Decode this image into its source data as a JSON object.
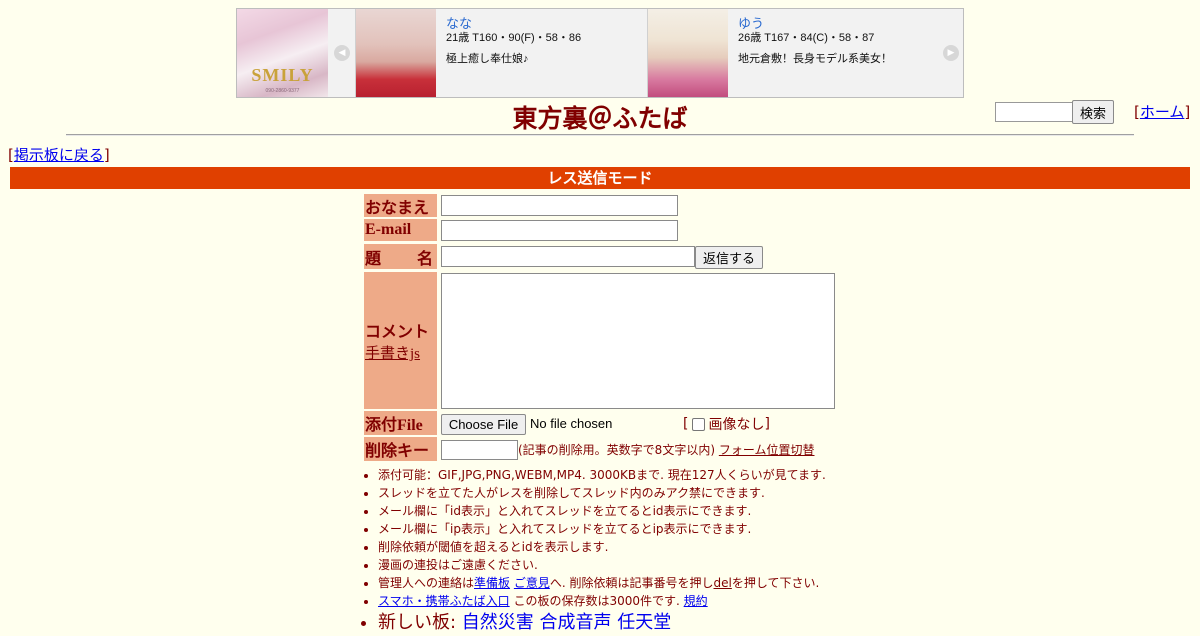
{
  "banner": {
    "shop_logo": "SMILY",
    "shop_sub": "090-2860-9377",
    "cards": [
      {
        "name": "なな",
        "spec": "21歳 T160・90(F)・58・86",
        "copy": "極上癒し奉仕娘♪"
      },
      {
        "name": "ゆう",
        "spec": "26歳 T167・84(C)・58・87",
        "copy": "地元倉敷！長身モデル系美女！"
      }
    ]
  },
  "header": {
    "title": "東方裏＠ふたば",
    "search_button": "検索",
    "home_link": "ホーム",
    "back_link": "掲示板に戻る"
  },
  "mode": "レス送信モード",
  "form": {
    "name_label": "おなまえ",
    "email_label": "E-mail",
    "subject_label_a": "題",
    "subject_label_b": "名",
    "submit": "返信する",
    "comment_label": "コメント",
    "handwriting": "手書きjs",
    "file_label": "添付File",
    "file_button": "Choose File",
    "file_status": "No file chosen",
    "no_image": "画像なし",
    "delkey_label": "削除キー",
    "delkey_note": "(記事の削除用。英数字で8文字以内)",
    "form_toggle": "フォーム位置切替"
  },
  "notes": {
    "n1": "添付可能：GIF,JPG,PNG,WEBM,MP4. 3000KBまで. 現在127人くらいが見てます.",
    "n2": "スレッドを立てた人がレスを削除してスレッド内のみアク禁にできます.",
    "n3": "メール欄に「id表示」と入れてスレッドを立てるとid表示にできます.",
    "n4": "メール欄に「ip表示」と入れてスレッドを立てるとip表示にできます.",
    "n5": "削除依頼が閾値を超えるとidを表示します.",
    "n6": "漫画の連投はご遠慮ください.",
    "n7_pre": "管理人への連絡は",
    "n7_link1": "準備板",
    "n7_link2": "ご意見",
    "n7_mid": "へ. 削除依頼は記事番号を押し",
    "n7_del": "del",
    "n7_post": "を押して下さい.",
    "n8_link": "スマホ・携帯ふたば入口",
    "n8_mid": " この板の保存数は3000件です. ",
    "n8_rules": "規約",
    "n9_pre": "新しい板: ",
    "n9_links": [
      "自然災害",
      "合成音声",
      "任天堂"
    ]
  }
}
